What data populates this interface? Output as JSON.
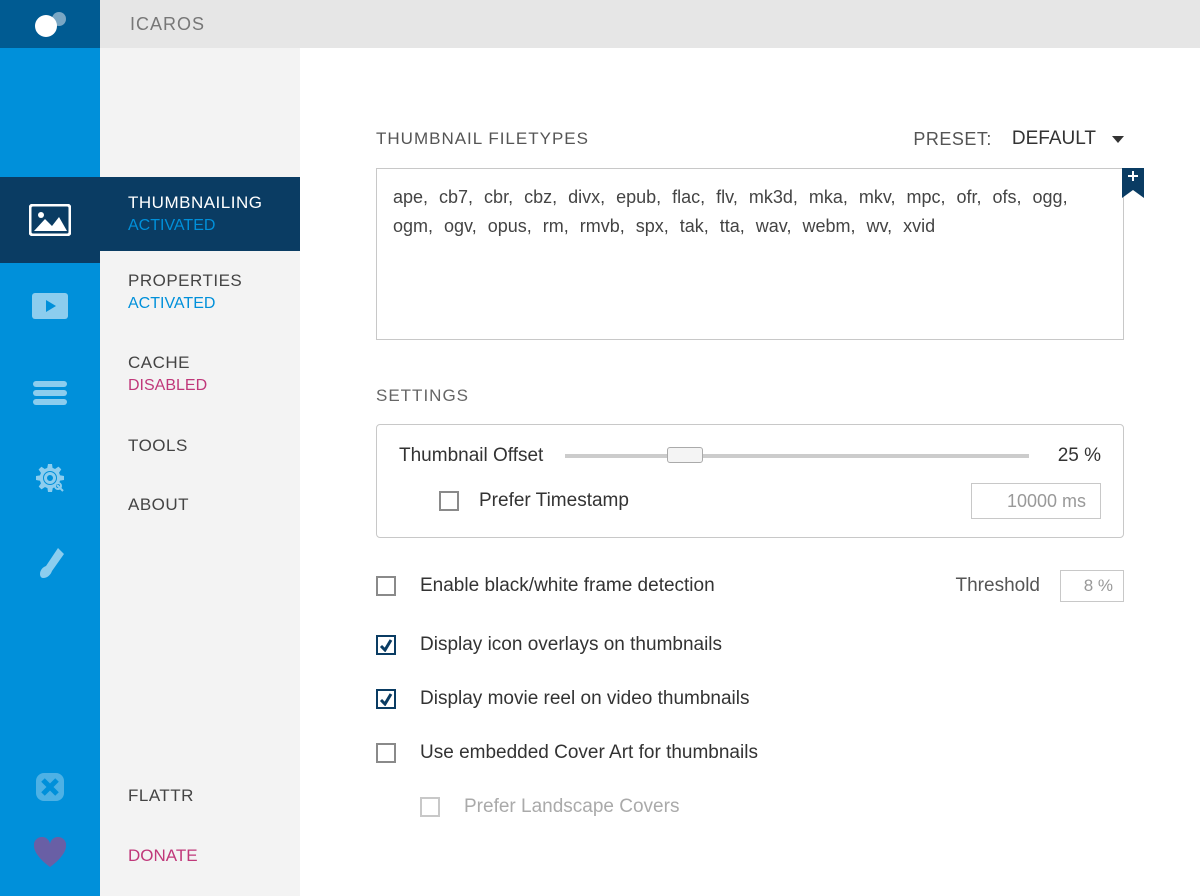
{
  "app_title": "ICAROS",
  "rail": {
    "items": [
      {
        "id": "thumbnailing"
      },
      {
        "id": "properties"
      },
      {
        "id": "cache"
      },
      {
        "id": "tools"
      },
      {
        "id": "about"
      }
    ],
    "bottom": [
      {
        "id": "flattr"
      },
      {
        "id": "donate"
      }
    ]
  },
  "nav": {
    "items": [
      {
        "title": "THUMBNAILING",
        "status": "ACTIVATED",
        "active": true
      },
      {
        "title": "PROPERTIES",
        "status": "ACTIVATED",
        "disabled": false
      },
      {
        "title": "CACHE",
        "status": "DISABLED",
        "disabled": true
      },
      {
        "title": "TOOLS",
        "status": ""
      },
      {
        "title": "ABOUT",
        "status": ""
      }
    ],
    "bottom": [
      {
        "title": "FLATTR"
      },
      {
        "title": "DONATE"
      }
    ]
  },
  "main": {
    "filetypes_label": "THUMBNAIL FILETYPES",
    "preset_label": "PRESET:",
    "preset_value": "DEFAULT",
    "filetypes_text": "ape, cb7, cbr, cbz, divx, epub, flac, flv, mk3d, mka, mkv, mpc, ofr, ofs, ogg, ogm, ogv, opus, rm, rmvb, spx, tak, tta, wav, webm, wv, xvid",
    "settings_label": "SETTINGS",
    "offset": {
      "label": "Thumbnail Offset",
      "value": "25 %",
      "percent": 25,
      "prefer_timestamp_label": "Prefer Timestamp",
      "timestamp_value": "10000 ms"
    },
    "options": {
      "bw_detection": {
        "label": "Enable black/white frame detection",
        "checked": false,
        "threshold_label": "Threshold",
        "threshold_value": "8 %"
      },
      "icon_overlays": {
        "label": "Display icon overlays on thumbnails",
        "checked": true
      },
      "movie_reel": {
        "label": "Display movie reel on video thumbnails",
        "checked": true
      },
      "cover_art": {
        "label": "Use embedded Cover Art for thumbnails",
        "checked": false
      },
      "landscape": {
        "label": "Prefer Landscape Covers",
        "checked": false
      }
    }
  }
}
